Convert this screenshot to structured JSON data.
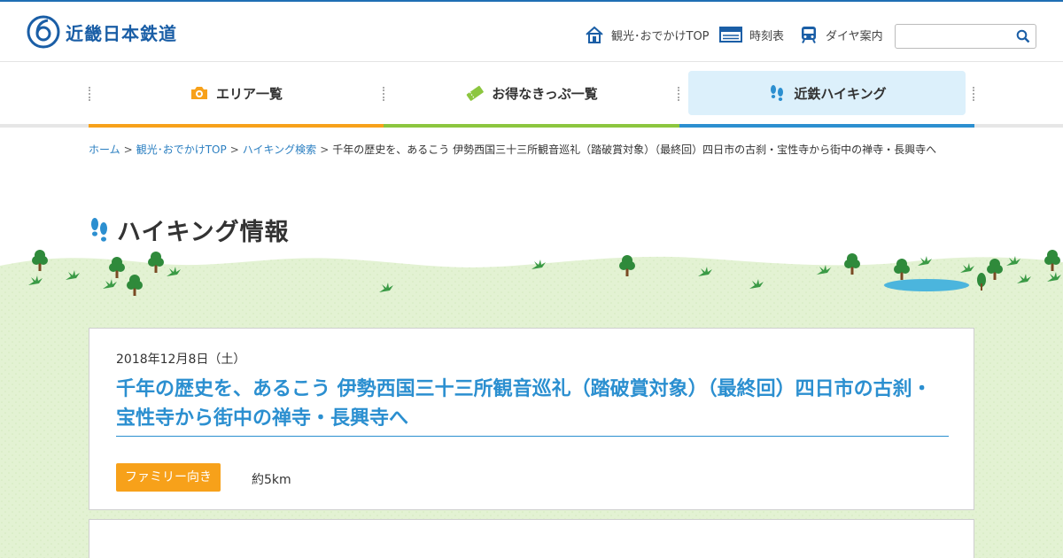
{
  "header": {
    "logo_text": "近畿日本鉄道",
    "util_nav": [
      {
        "label": "観光･おでかけTOP",
        "icon": "house-icon"
      },
      {
        "label": "時刻表",
        "icon": "timetable-icon"
      },
      {
        "label": "ダイヤ案内",
        "icon": "train-icon"
      }
    ],
    "search": {
      "placeholder": "",
      "value": ""
    }
  },
  "global_nav": [
    {
      "label": "エリア一覧",
      "icon": "camera-icon",
      "accent": "#f7a11a"
    },
    {
      "label": "お得なきっぷ一覧",
      "icon": "ticket-icon",
      "accent": "#8cc63f"
    },
    {
      "label": "近鉄ハイキング",
      "icon": "footprints-icon",
      "accent": "#2c8fd0",
      "active": true
    }
  ],
  "breadcrumb": {
    "items": [
      "ホーム",
      "観光･おでかけTOP",
      "ハイキング検索"
    ],
    "current": "千年の歴史を、あるこう 伊勢西国三十三所観音巡礼（踏破賞対象）（最終回）四日市の古刹・宝性寺から街中の禅寺・長興寺へ",
    "separator": ">"
  },
  "page": {
    "heading": "ハイキング情報",
    "heading_icon": "footprints-icon"
  },
  "event": {
    "date": "2018年12月8日（土）",
    "title": "千年の歴史を、あるこう 伊勢西国三十三所観音巡礼（踏破賞対象）（最終回）四日市の古刹・宝性寺から街中の禅寺・長興寺へ",
    "badge": "ファミリー向き",
    "distance": "約5km"
  },
  "colors": {
    "brand_blue": "#1a5ea6",
    "link_blue": "#2b8fd0",
    "orange": "#f7a11a",
    "green": "#8cc63f",
    "active_tab_bg": "#dcf0fb",
    "meadow": "#e3f2d3"
  }
}
